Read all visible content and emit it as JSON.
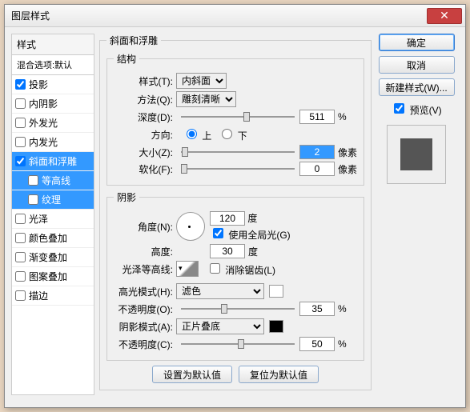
{
  "title": "图层样式",
  "buttons": {
    "ok": "确定",
    "cancel": "取消",
    "new_style": "新建样式(W)...",
    "preview": "预览(V)",
    "defaults": "设置为默认值",
    "reset": "复位为默认值"
  },
  "styles_panel": {
    "header": "样式",
    "blend": "混合选项:默认",
    "items": [
      "投影",
      "内阴影",
      "外发光",
      "内发光",
      "斜面和浮雕",
      "等高线",
      "纹理",
      "光泽",
      "颜色叠加",
      "渐变叠加",
      "图案叠加",
      "描边"
    ],
    "checked": [
      0,
      4
    ],
    "selected_child": 6
  },
  "bevel": {
    "group": "斜面和浮雕",
    "structure": "结构",
    "style_lbl": "样式(T):",
    "style_val": "内斜面",
    "technique_lbl": "方法(Q):",
    "technique_val": "雕刻清晰",
    "depth_lbl": "深度(D):",
    "depth_val": "511",
    "depth_unit": "%",
    "direction_lbl": "方向:",
    "up": "上",
    "down": "下",
    "size_lbl": "大小(Z):",
    "size_val": "2",
    "size_unit": "像素",
    "soften_lbl": "软化(F):",
    "soften_val": "0",
    "soften_unit": "像素"
  },
  "shading": {
    "group": "阴影",
    "angle_lbl": "角度(N):",
    "angle_val": "120",
    "deg": "度",
    "global": "使用全局光(G)",
    "altitude_lbl": "高度:",
    "altitude_val": "30",
    "contour_lbl": "光泽等高线:",
    "antialias": "消除锯齿(L)",
    "hl_mode_lbl": "高光模式(H):",
    "hl_mode_val": "滤色",
    "opacity_lbl": "不透明度(O):",
    "opacity_val": "35",
    "sh_mode_lbl": "阴影模式(A):",
    "sh_mode_val": "正片叠底",
    "sh_opacity_lbl": "不透明度(C):",
    "sh_opacity_val": "50",
    "pct": "%"
  }
}
